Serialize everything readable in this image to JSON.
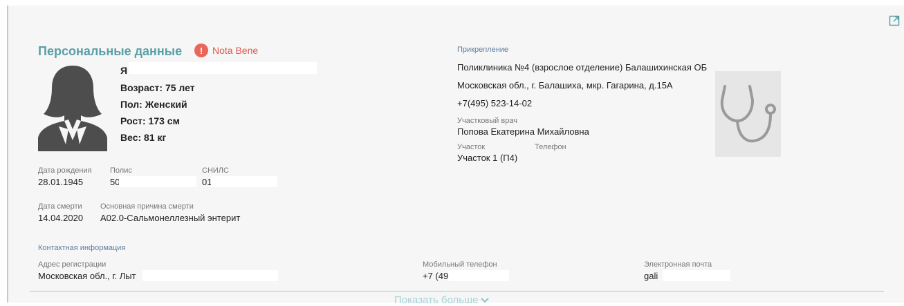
{
  "personal": {
    "title": "Персональные данные",
    "nota_icon": "!",
    "nota_label": "Nota Bene",
    "name_initial": "Я",
    "age": "Возраст: 75 лет",
    "sex": "Пол: Женский",
    "height": "Рост: 173 см",
    "weight": "Вес: 81 кг",
    "avatar_icon": "female-silhouette-icon"
  },
  "ids": {
    "dob_label": "Дата рождения",
    "dob": "28.01.1945",
    "polis_label": "Полис",
    "polis": "50",
    "snils_label": "СНИЛС",
    "snils": "01"
  },
  "death": {
    "date_label": "Дата смерти",
    "date": "14.04.2020",
    "cause_label": "Основная причина смерти",
    "cause": "A02.0-Сальмонеллезный энтерит"
  },
  "attachment": {
    "section_label": "Прикрепление",
    "clinic": "Поликлиника №4 (взрослое отделение) Балашихинская ОБ",
    "address": "Московская обл., г. Балашиха, мкр. Гагарина, д.15А",
    "phone": "+7(495) 523-14-02",
    "doctor_label": "Участковый врач",
    "doctor": "Попова Екатерина Михайловна",
    "area_label": "Участок",
    "area": "Участок 1 (П4)",
    "area_phone_label": "Телефон",
    "icon": "stethoscope-icon"
  },
  "contacts": {
    "section_label": "Контактная информация",
    "address_label": "Адрес регистрации",
    "address": "Московская обл., г. Лыт",
    "mobile_label": "Мобильный телефон",
    "mobile": "+7 (49",
    "email_label": "Электронная почта",
    "email": "gali"
  },
  "footer": {
    "show_more": "Показать больше",
    "chevron_icon": "chevron-down-icon"
  },
  "colors": {
    "title": "#5a9fa6",
    "nota": "#e0594b",
    "section_label": "#5d7fa0",
    "show_more": "#a7d3d6"
  }
}
